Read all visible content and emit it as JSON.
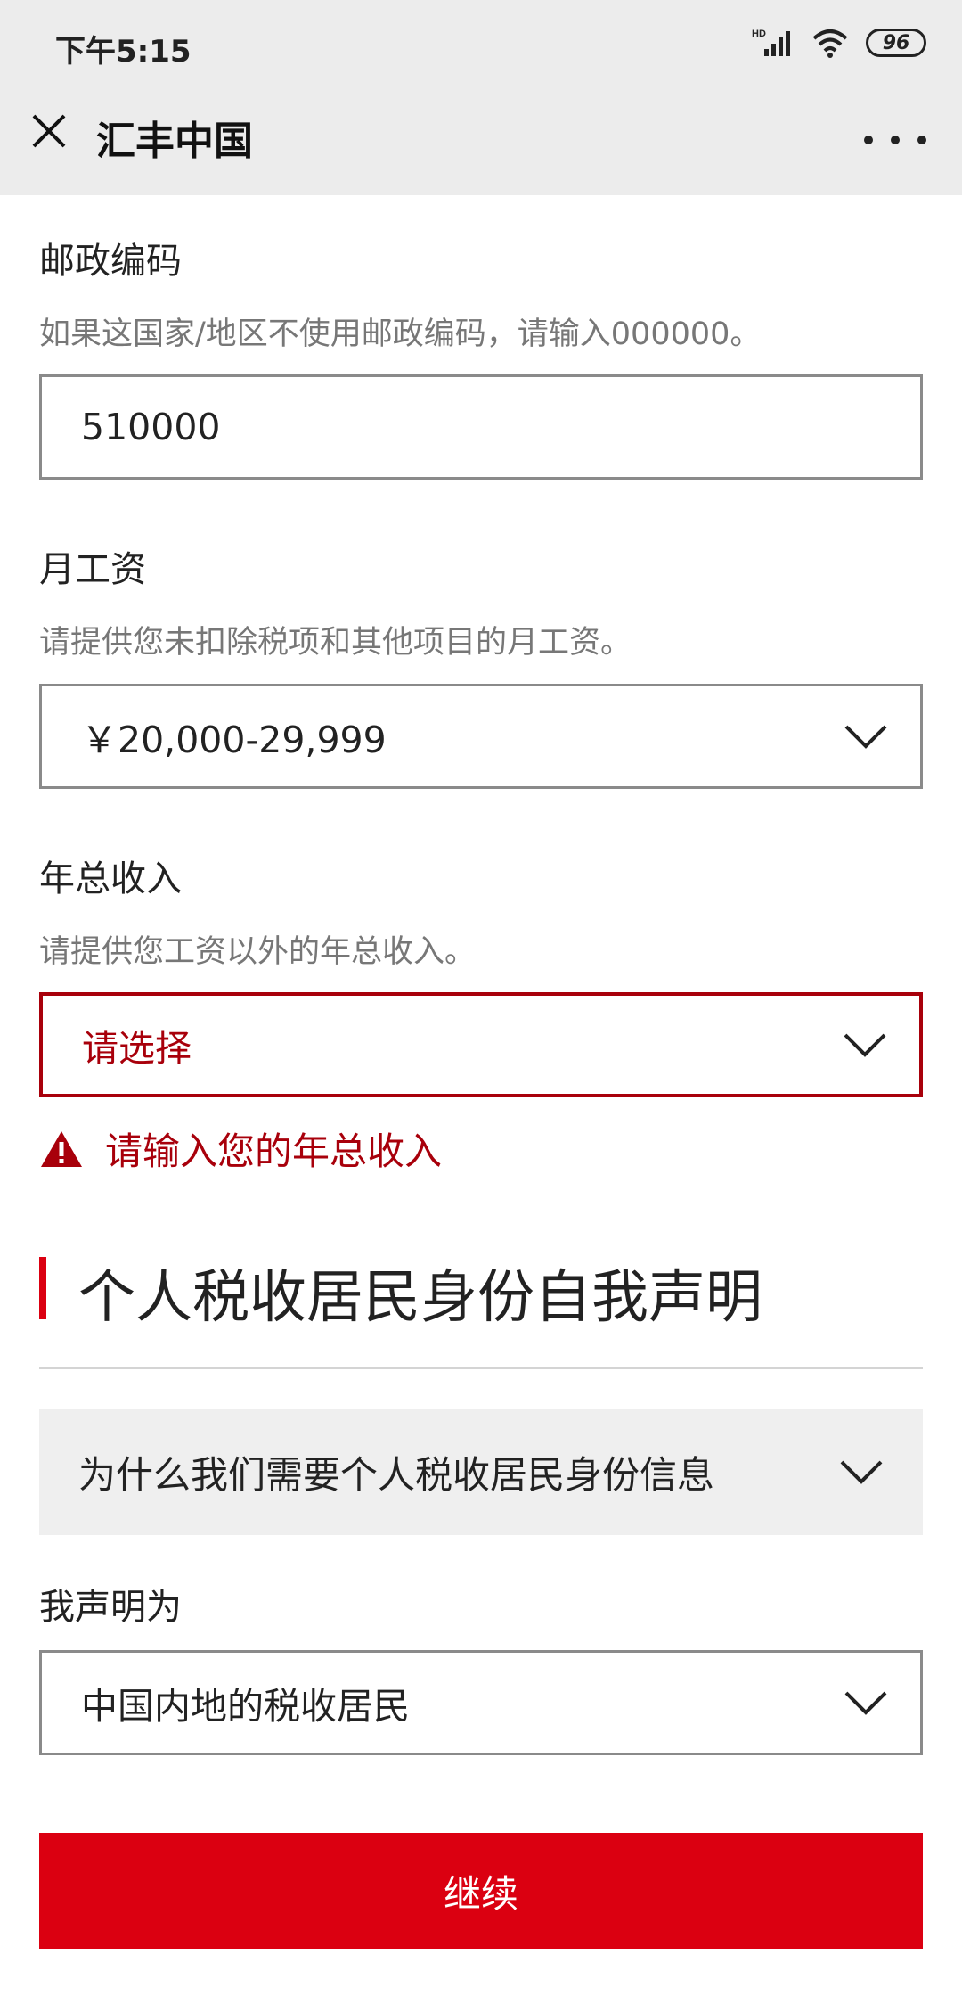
{
  "status_bar": {
    "time": "下午5:15",
    "battery": "96"
  },
  "header": {
    "title": "汇丰中国"
  },
  "postal": {
    "label": "邮政编码",
    "hint": "如果这国家/地区不使用邮政编码，请输入000000。",
    "value": "510000"
  },
  "salary": {
    "label": "月工资",
    "hint": "请提供您未扣除税项和其他项目的月工资。",
    "value": "￥20,000-29,999"
  },
  "annual_income": {
    "label": "年总收入",
    "hint": "请提供您工资以外的年总收入。",
    "value": "请选择",
    "error": "请输入您的年总收入"
  },
  "tax_section": {
    "title": "个人税收居民身份自我声明",
    "accordion": "为什么我们需要个人税收居民身份信息"
  },
  "declaration": {
    "label": "我声明为",
    "value": "中国内地的税收居民"
  },
  "continue_label": "继续",
  "colors": {
    "brand_red": "#db0011",
    "error_red": "#a8000b"
  }
}
